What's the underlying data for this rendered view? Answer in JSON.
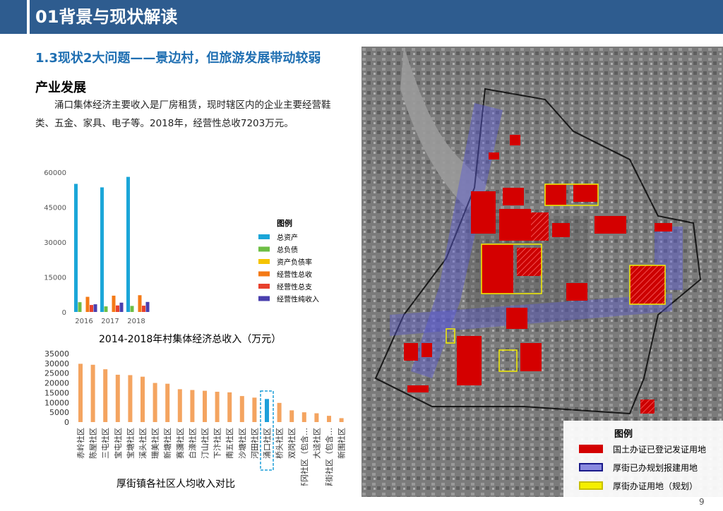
{
  "header": {
    "title": "01背景与现状解读"
  },
  "subtitle": "1.3现状2大问题——景边村，但旅游发展带动较弱",
  "section_title": "产业发展",
  "body_text": "涌口集体经济主要收入是厂房租赁，现时辖区内的企业主要经营鞋类、五金、家具、电子等。2018年，经营性总收7203万元。",
  "chart_top": {
    "chart_data": {
      "type": "bar",
      "categories": [
        "2016",
        "2017",
        "2018"
      ],
      "ylim": [
        0,
        60000
      ],
      "yticks": [
        "60000",
        "45000",
        "30000",
        "15000",
        "0"
      ],
      "legend_title": "图例",
      "series": [
        {
          "name": "总资产",
          "color": "#1ba6d8",
          "values": [
            55000,
            53500,
            58000
          ]
        },
        {
          "name": "总负债",
          "color": "#6dbe45",
          "values": [
            4200,
            2400,
            2600
          ]
        },
        {
          "name": "资产负债率",
          "color": "#f5c400",
          "values": [
            0,
            0,
            0
          ]
        },
        {
          "name": "经营性总收",
          "color": "#f47a16",
          "values": [
            6500,
            7000,
            7203
          ]
        },
        {
          "name": "经营性总支",
          "color": "#e8412e",
          "values": [
            3000,
            2800,
            2700
          ]
        },
        {
          "name": "经营性纯收入",
          "color": "#4a3fae",
          "values": [
            3300,
            4000,
            4300
          ]
        }
      ]
    }
  },
  "chart_mid": {
    "chart_data": {
      "type": "bar",
      "title": "2014-2018年村集体经济总收入（万元）",
      "ylim": [
        0,
        35000
      ],
      "yticks": [
        "35000",
        "30000",
        "25000",
        "20000",
        "15000",
        "10000",
        "5000",
        "0"
      ],
      "categories": [
        "赤岭社区",
        "陈屋社区",
        "三屯社区",
        "宝屯社区",
        "宝塘社区",
        "溪头社区",
        "珊美社区",
        "新塘社区",
        "赛瀰社区",
        "白濠社区",
        "汀山社区",
        "下汴社区",
        "南五社区",
        "沙塘社区",
        "河田社区",
        "涌口社区",
        "桥头社区",
        "双岗社区",
        "环冈社区（包含…",
        "大迳社区",
        "厚街社区（包含…",
        "新围社区"
      ],
      "values": [
        29800,
        29300,
        27000,
        24200,
        24000,
        23200,
        20000,
        19600,
        16800,
        16400,
        16000,
        15500,
        15200,
        13300,
        12500,
        11800,
        9800,
        6000,
        5000,
        4500,
        3200,
        2000
      ],
      "highlight": "涌口社区",
      "bar_color": "#f4a460",
      "highlight_color": "#1e9fd9"
    }
  },
  "chart_bottom_caption": "厚街镇各社区人均收入对比",
  "map": {
    "legend_title": "图例",
    "legend": [
      {
        "label": "国土办证已登记发证用地",
        "color": "#d40000"
      },
      {
        "label": "厚街已办规划报建用地",
        "color": "#7a7ad0"
      },
      {
        "label": "厚街办证用地（规划）",
        "color": "#f5ef00"
      }
    ]
  },
  "page_number": "9"
}
